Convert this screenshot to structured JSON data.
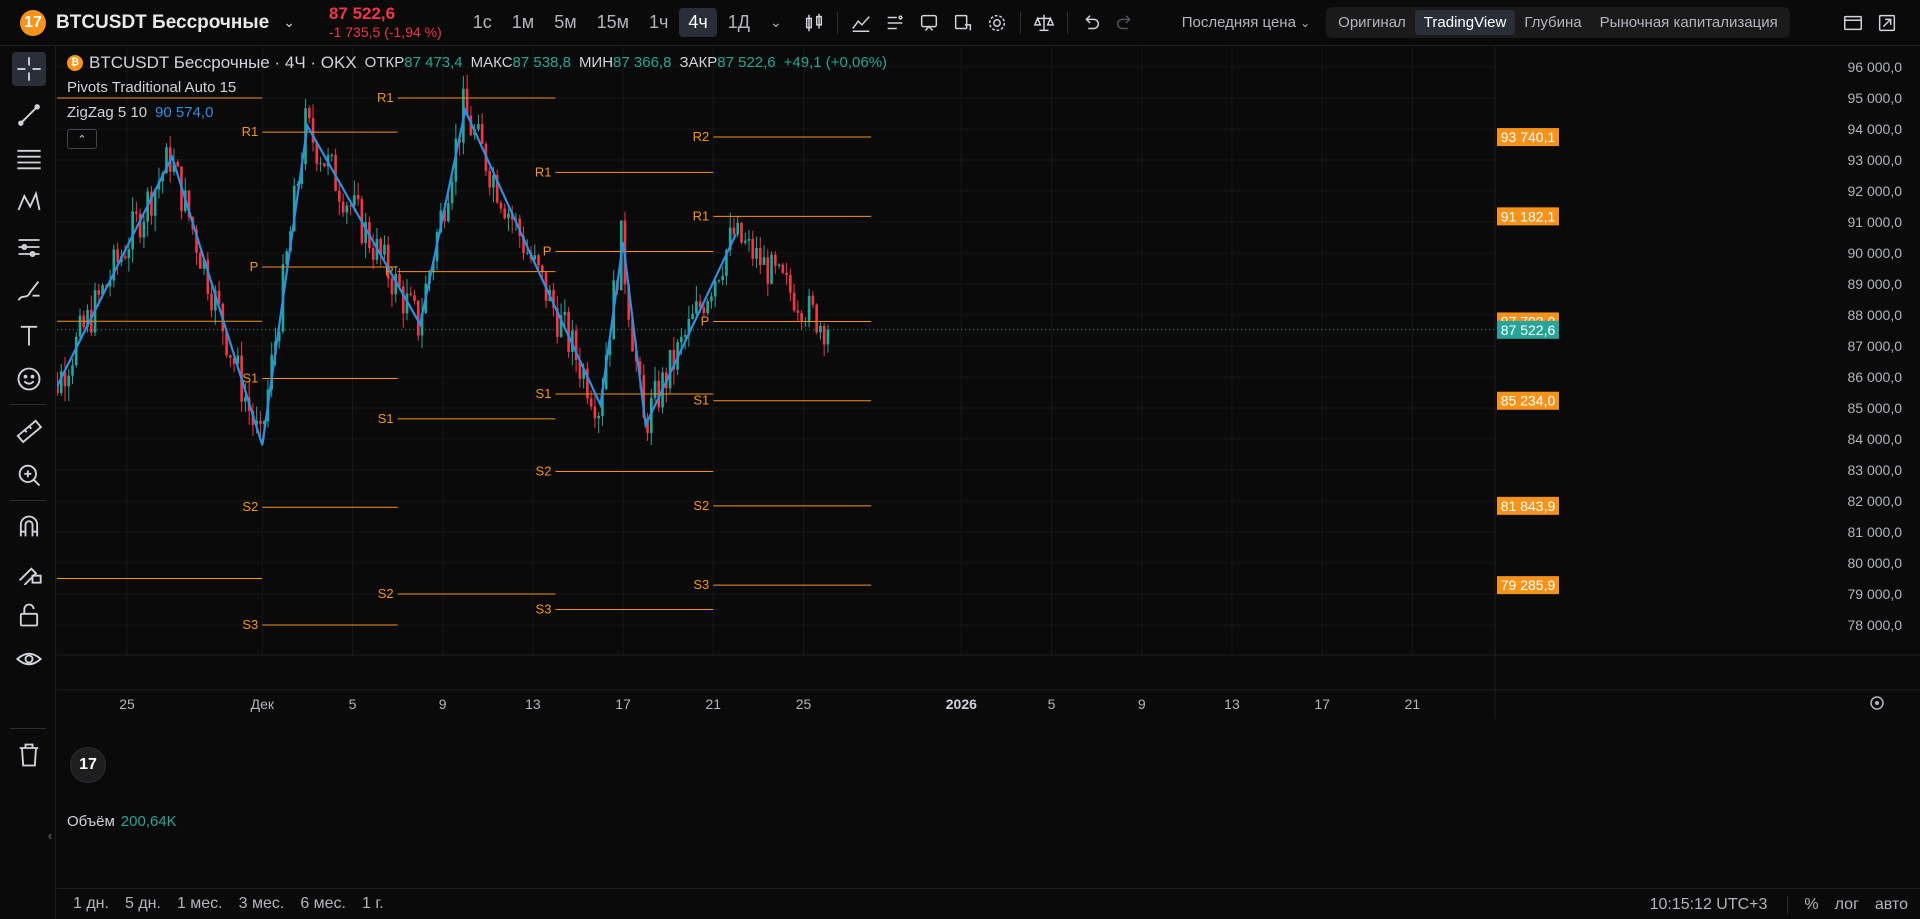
{
  "header": {
    "coin_symbol": "₿",
    "symbol_title": "BTCUSDT Бессрочные",
    "last_price": "87 522,6",
    "price_change": "-1 735,5 (-1,94 %)",
    "timeframes": [
      "1с",
      "1м",
      "5м",
      "15м",
      "1ч",
      "4ч",
      "1Д"
    ],
    "active_timeframe": "4ч",
    "last_price_mode": "Последняя цена",
    "views": [
      "Оригинал",
      "TradingView",
      "Глубина",
      "Рыночная капитализация"
    ],
    "active_view": "TradingView"
  },
  "legend": {
    "title": "BTCUSDT Бессрочные · 4Ч · OKX",
    "open_label": "ОТКР",
    "open": "87 473,4",
    "high_label": "МАКС",
    "high": "87 538,8",
    "low_label": "МИН",
    "low": "87 366,8",
    "close_label": "ЗАКР",
    "close": "87 522,6",
    "change": "+49,1 (+0,06%)",
    "indicator_pivots": "Pivots Traditional Auto 15",
    "indicator_zigzag": "ZigZag 5 10",
    "zigzag_value": "90 574,0"
  },
  "volume": {
    "label": "Объём",
    "value": "200,64K"
  },
  "logo_text": "17",
  "bottom": {
    "ranges": [
      "1 дн.",
      "5 дн.",
      "1 мес.",
      "3 мес.",
      "6 мес.",
      "1 г."
    ],
    "clock": "10:15:12 UTC+3",
    "percent": "%",
    "log": "лог",
    "auto": "авто"
  },
  "colors": {
    "up": "#26a69a",
    "down": "#f23645",
    "pivot": "#f7931a",
    "zigzag": "#2f8fe0",
    "background": "#0a0a0a"
  },
  "chart_data": {
    "type": "candlestick",
    "ylim": [
      77000,
      96500
    ],
    "y_ticks": [
      "96 000,0",
      "95 000,0",
      "94 000,0",
      "93 000,0",
      "92 000,0",
      "91 000,0",
      "90 000,0",
      "89 000,0",
      "88 000,0",
      "87 000,0",
      "86 000,0",
      "85 000,0",
      "84 000,0",
      "83 000,0",
      "82 000,0",
      "81 000,0",
      "80 000,0",
      "79 000,0",
      "78 000,0"
    ],
    "x_ticks": [
      "25",
      "Дек",
      "5",
      "9",
      "13",
      "17",
      "21",
      "25",
      "2026",
      "5",
      "9",
      "13",
      "17",
      "21"
    ],
    "x_tick_bold": "2026",
    "price_tags": [
      {
        "value": 93740.1,
        "label": "93 740,1",
        "color": "#f7931a"
      },
      {
        "value": 91182.1,
        "label": "91 182,1",
        "color": "#f7931a"
      },
      {
        "value": 87792.0,
        "label": "87 792,0",
        "color": "#f7931a"
      },
      {
        "value": 87522.6,
        "label": "87 522,6",
        "color": "#26a69a"
      },
      {
        "value": 85234.0,
        "label": "85 234,0",
        "color": "#f7931a"
      },
      {
        "value": 81843.9,
        "label": "81 843,9",
        "color": "#f7931a"
      },
      {
        "value": 79285.9,
        "label": "79 285,9",
        "color": "#f7931a"
      }
    ],
    "pivot_periods": [
      {
        "from": "21 Nov",
        "to": "Дек",
        "levels": [
          {
            "name": "R1",
            "value": 95000
          },
          {
            "name": "P",
            "value": 87800
          },
          {
            "name": "S1",
            "value": 79500
          }
        ]
      },
      {
        "from": "Дек",
        "to": "7 Dec",
        "levels": [
          {
            "name": "R1",
            "value": 93900
          },
          {
            "name": "P",
            "value": 89550
          },
          {
            "name": "S1",
            "value": 85950
          },
          {
            "name": "S2",
            "value": 81800
          },
          {
            "name": "S3",
            "value": 78000
          }
        ]
      },
      {
        "from": "7 Dec",
        "to": "14 Dec",
        "levels": [
          {
            "name": "R1",
            "value": 95000
          },
          {
            "name": "P",
            "value": 89400
          },
          {
            "name": "S1",
            "value": 84650
          },
          {
            "name": "S2",
            "value": 79000
          }
        ]
      },
      {
        "from": "14 Dec",
        "to": "21 Dec",
        "levels": [
          {
            "name": "R1",
            "value": 92600
          },
          {
            "name": "P",
            "value": 90050
          },
          {
            "name": "S1",
            "value": 85450
          },
          {
            "name": "S2",
            "value": 82950
          },
          {
            "name": "S3",
            "value": 78500
          }
        ]
      },
      {
        "from": "21 Dec",
        "to": "28 Dec",
        "levels": [
          {
            "name": "R2",
            "value": 93740.1
          },
          {
            "name": "R1",
            "value": 91182.1
          },
          {
            "name": "P",
            "value": 87792.0
          },
          {
            "name": "S1",
            "value": 85234.0
          },
          {
            "name": "S2",
            "value": 81843.9
          },
          {
            "name": "S3",
            "value": 79285.9
          }
        ]
      }
    ],
    "zigzag": [
      {
        "date": "21 Nov",
        "price": 84400
      },
      {
        "date": "27 Nov",
        "price": 93100
      },
      {
        "date": "1 Dec",
        "price": 83800
      },
      {
        "date": "3 Dec",
        "price": 94100
      },
      {
        "date": "8 Dec",
        "price": 87700
      },
      {
        "date": "10 Dec",
        "price": 94600
      },
      {
        "date": "13 Dec",
        "price": 89800
      },
      {
        "date": "16 Dec",
        "price": 85100
      },
      {
        "date": "17 Dec",
        "price": 90350
      },
      {
        "date": "18 Dec",
        "price": 84450
      },
      {
        "date": "22 Dec",
        "price": 90600
      }
    ],
    "last_value": 87522.6
  }
}
